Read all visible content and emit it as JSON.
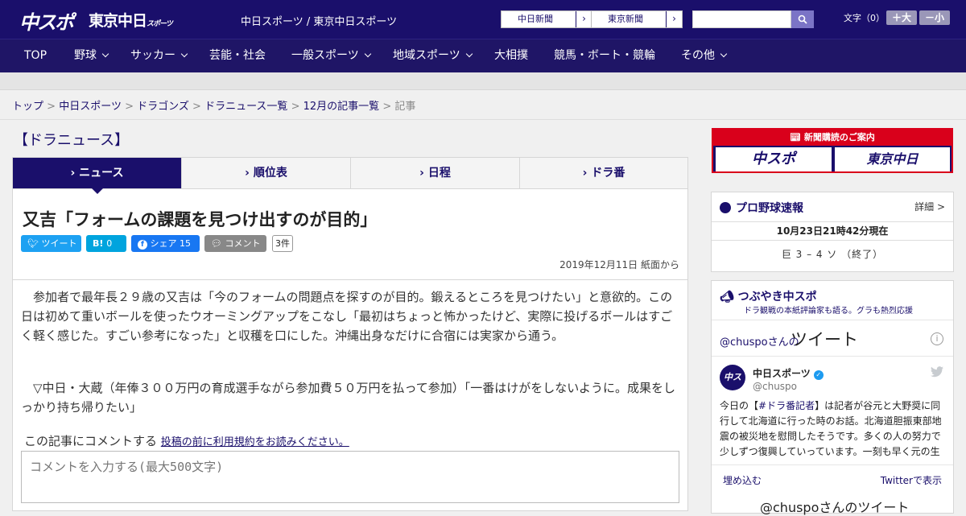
{
  "header": {
    "logo_chuspo": "中スポ",
    "logo_tokyo": "東京中日",
    "logo_tokyo_sub": "スポーツ",
    "site_name": "中日スポーツ / 東京中日スポーツ",
    "link_chunichi": "中日新聞",
    "link_tokyo": "東京新聞",
    "search_placeholder": "",
    "font_size_label": "文字（0）",
    "font_bigger": "＋大",
    "font_smaller": "－小"
  },
  "nav": {
    "items": [
      "TOP",
      "野球",
      "サッカー",
      "芸能・社会",
      "一般スポーツ",
      "地域スポーツ",
      "大相撲",
      "競馬・ボート・競輪",
      "その他"
    ]
  },
  "breadcrumb": {
    "items": [
      "トップ",
      "中日スポーツ",
      "ドラゴンズ",
      "ドラニュース一覧",
      "12月の記事一覧"
    ],
    "current": "記事",
    "separator": ">"
  },
  "section_title": "【ドラニュース】",
  "tabs": [
    "ニュース",
    "順位表",
    "日程",
    "ドラ番"
  ],
  "article": {
    "headline": "又吉「フォームの課題を見つけ出すのが目的」",
    "share": {
      "tweet": "ツイート",
      "hatena": "B!",
      "hatena_count": "0",
      "facebook": "シェア",
      "facebook_count": "15",
      "comment": "コメント",
      "comment_count": "3件"
    },
    "dateline": "2019年12月11日 紙面から",
    "paragraphs": [
      "　参加者で最年長２９歳の又吉は「今のフォームの問題点を探すのが目的。鍛えるところを見つけたい」と意欲的。この日は初めて重いボールを使ったウオーミングアップをこなし「最初はちょっと怖かったけど、実際に投げるボールはすごく軽く感じた。すごい参考になった」と収穫を口にした。沖縄出身なだけに合宿には実家から通う。",
      "　▽中日・大蔵（年俸３００万円の育成選手ながら参加費５０万円を払って参加）「一番はけがをしないように。成果をしっかり持ち帰りたい」"
    ],
    "comment_prompt": "この記事にコメントする",
    "comment_terms_link": "投稿の前に利用規約をお読みください。",
    "comment_placeholder": "コメントを入力する(最大500文字)"
  },
  "sidebar": {
    "promo": {
      "title": "新聞購読のご案内",
      "logo_left": "中スポ",
      "logo_right": "東京中日"
    },
    "scores": {
      "title": "プロ野球速報",
      "more": "詳細 >",
      "updated": "10月23日21時42分現在",
      "game": "巨 3 – 4 ソ （終了）"
    },
    "tweets": {
      "title": "つぶやき中スポ",
      "subtitle": "ドラ観戦の本紙評論家も語る。グラも熱烈応援",
      "handle": "@chuspoさんの",
      "heading": "ツイート",
      "account_name": "中日スポーツ",
      "account_user": "@chuspo",
      "tweet_prefix": "今日の【",
      "tweet_hashtag": "#ドラ番記者",
      "tweet_body": "】は記者が谷元と大野奨に同行して北海道に行った時のお話。北海道胆振東部地震の被災地を慰問したそうです。多くの人の努力で少しずつ復興していっています。一刻も早く元の生",
      "embed": "埋め込む",
      "view_on_twitter": "Twitterで表示",
      "bottom_heading": "@chuspoさんのツイート"
    }
  },
  "colors": {
    "brand_navy": "#1a0f6b",
    "promo_red": "#d9001b",
    "twitter_blue": "#1da1f2",
    "hatena_blue": "#00a4de",
    "facebook_blue": "#1877f2",
    "comment_gray": "#888888"
  }
}
